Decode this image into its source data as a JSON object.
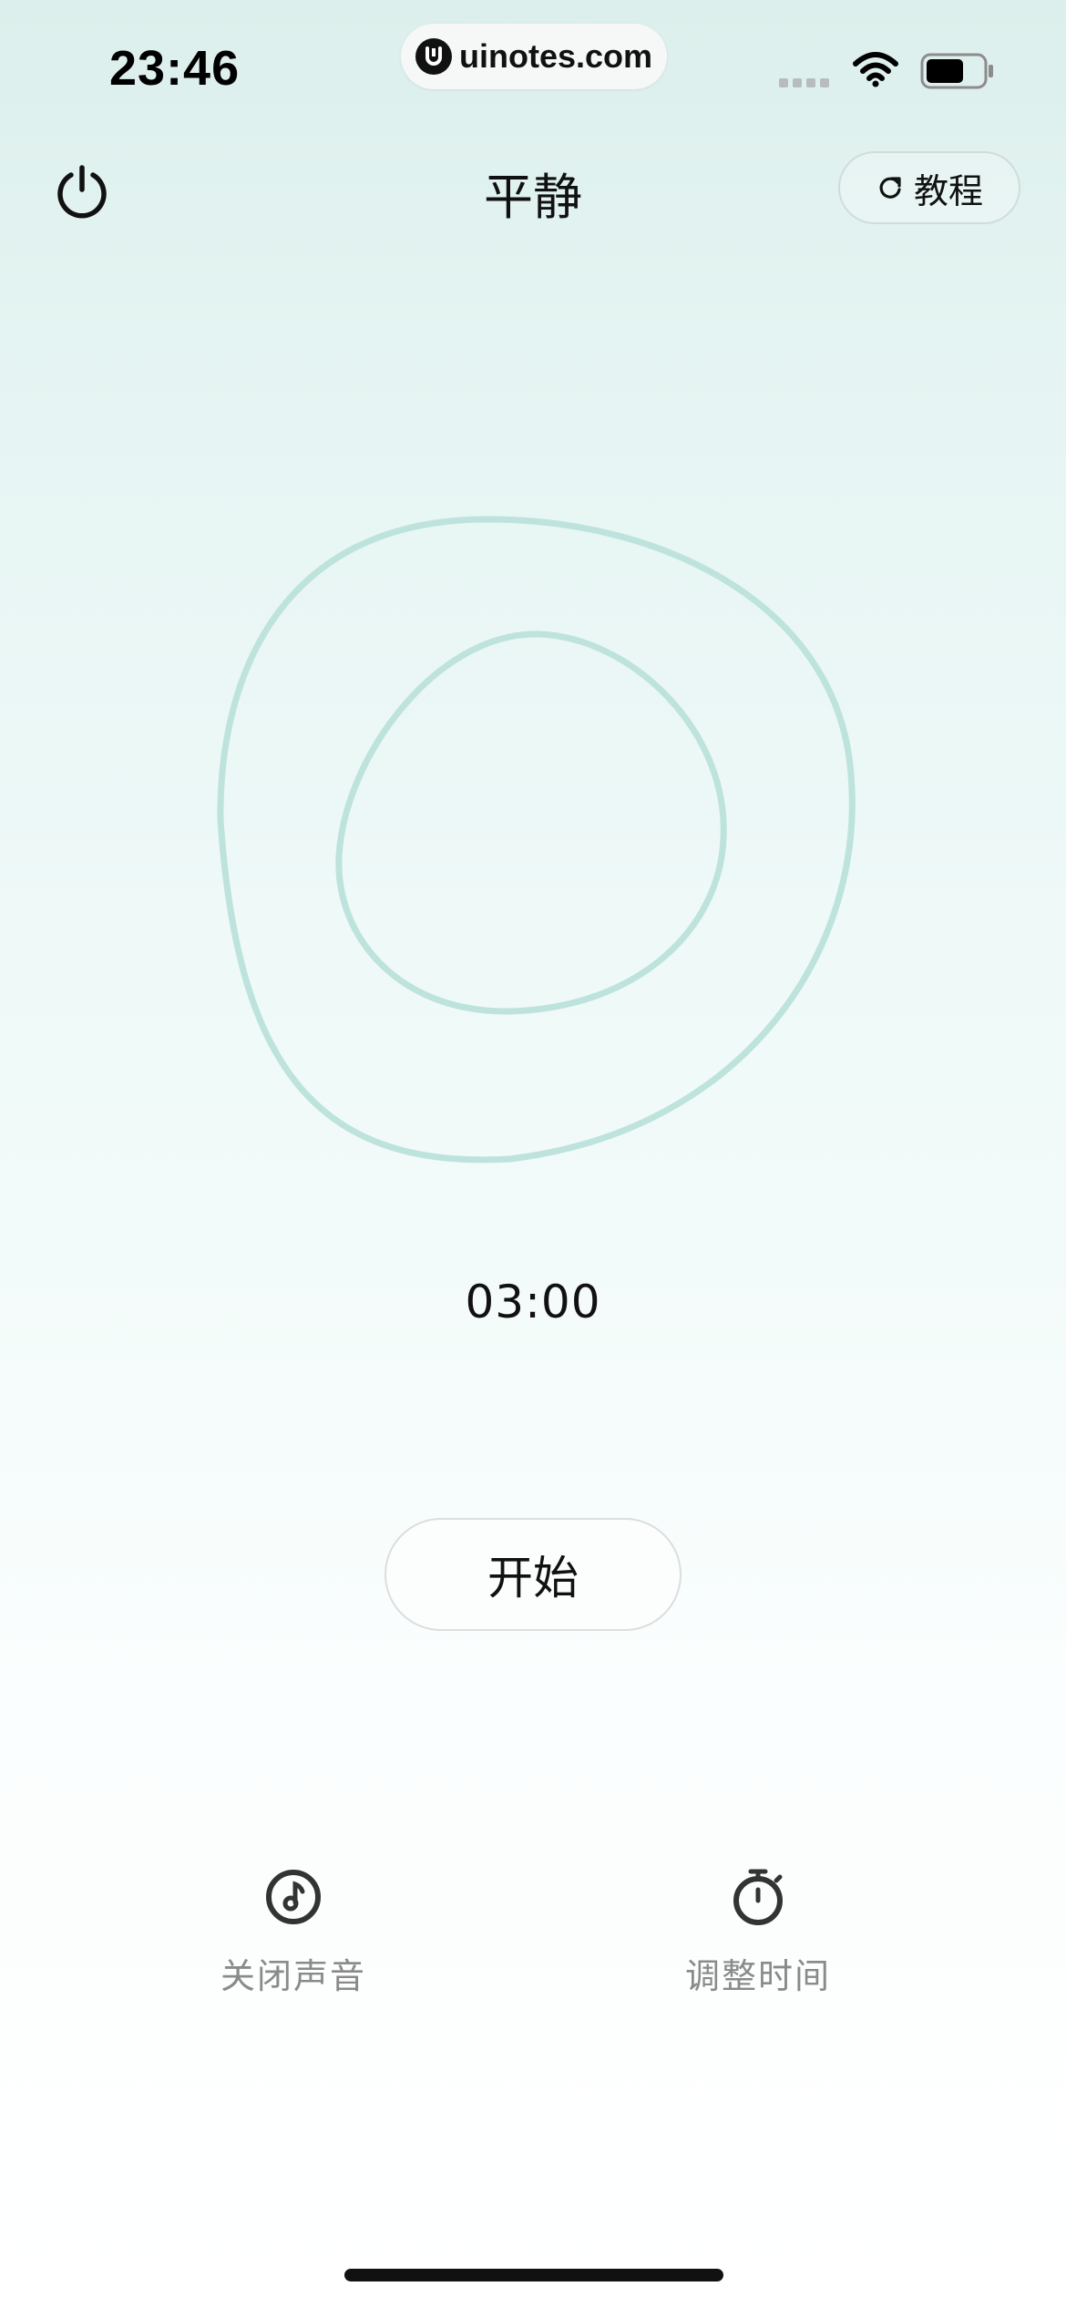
{
  "status_bar": {
    "time": "23:46",
    "url": "uinotes.com",
    "icons": [
      "signal-dots-icon",
      "wifi-icon",
      "battery-icon"
    ]
  },
  "header": {
    "title": "平静",
    "tutorial_label": "教程",
    "power_icon": "power-icon",
    "refresh_icon": "refresh-icon"
  },
  "breathing": {
    "ring_color": "#bde3dc"
  },
  "timer": {
    "display": "03:00"
  },
  "start_button": {
    "label": "开始"
  },
  "bottom_actions": [
    {
      "icon": "music-note-icon",
      "label": "关闭声音"
    },
    {
      "icon": "stopwatch-icon",
      "label": "调整时间"
    }
  ]
}
